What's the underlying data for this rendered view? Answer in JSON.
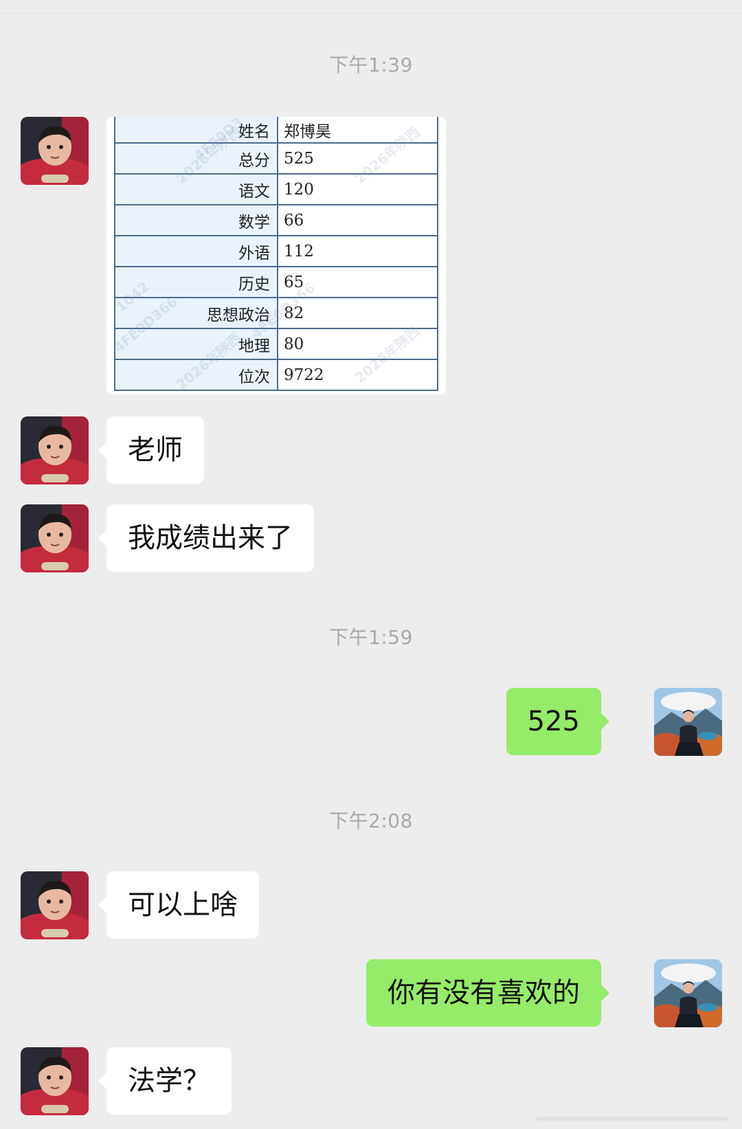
{
  "chat": {
    "timestamps": [
      "下午1:39",
      "下午1:59",
      "下午2:08"
    ],
    "score_table": {
      "rows": [
        {
          "label": "姓名",
          "value": "郑博昊"
        },
        {
          "label": "总分",
          "value": "525"
        },
        {
          "label": "语文",
          "value": "120"
        },
        {
          "label": "数学",
          "value": "66"
        },
        {
          "label": "外语",
          "value": "112"
        },
        {
          "label": "历史",
          "value": "65"
        },
        {
          "label": "思想政治",
          "value": "82"
        },
        {
          "label": "地理",
          "value": "80"
        },
        {
          "label": "位次",
          "value": "9722"
        }
      ],
      "watermarks": [
        "2026年陕西",
        "4FE0D366",
        "1042",
        "4FE0D3"
      ]
    },
    "messages": [
      {
        "sender": "other",
        "text": "老师"
      },
      {
        "sender": "other",
        "text": "我成绩出来了"
      },
      {
        "sender": "me",
        "text": "525"
      },
      {
        "sender": "other",
        "text": "可以上啥"
      },
      {
        "sender": "me",
        "text": "你有没有喜欢的"
      },
      {
        "sender": "other",
        "text": "法学？"
      }
    ]
  },
  "colors": {
    "background": "#ededed",
    "incoming_bubble": "#ffffff",
    "outgoing_bubble": "#95ec69",
    "timestamp_text": "#a9a9a9"
  }
}
